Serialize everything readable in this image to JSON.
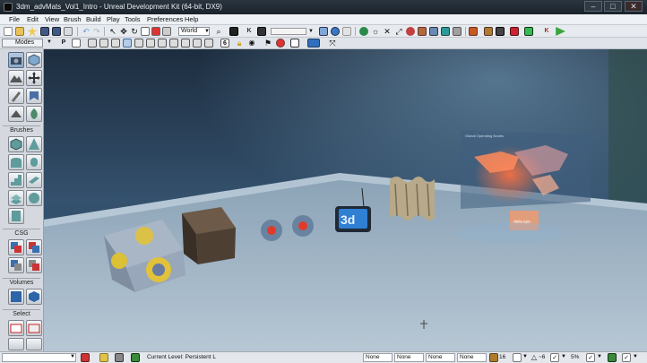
{
  "window": {
    "title": "3dm_advMats_Vol1_Intro - Unreal Development Kit (64-bit, DX9)",
    "minimize": "–",
    "maximize": "□",
    "close": "✕"
  },
  "menu": [
    "File",
    "Edit",
    "View",
    "Brush",
    "Build",
    "Play",
    "Tools",
    "Preferences",
    "Help"
  ],
  "toolbar": {
    "coord_system": "World"
  },
  "toolbar2": {
    "modes_label": "Modes",
    "p_label": "P",
    "six_label": "6"
  },
  "left_panel": {
    "sections": {
      "brushes": "Brushes",
      "csg": "CSG",
      "volumes": "Volumes",
      "select": "Select"
    }
  },
  "viewport": {
    "screen_title": "Global Operating Nodes",
    "tv_label": "3d",
    "small_panel_text": "data.sys"
  },
  "status": {
    "current_level": "Current Level:  Persistent L",
    "fields": [
      "None",
      "None",
      "None",
      "None"
    ],
    "grid_value": "16",
    "rotation_value": "~6",
    "scale_value": "5%"
  },
  "colors": {
    "accent": "#4d8cc8",
    "play_green": "#3aa53a",
    "red_icon": "#d0302a"
  }
}
